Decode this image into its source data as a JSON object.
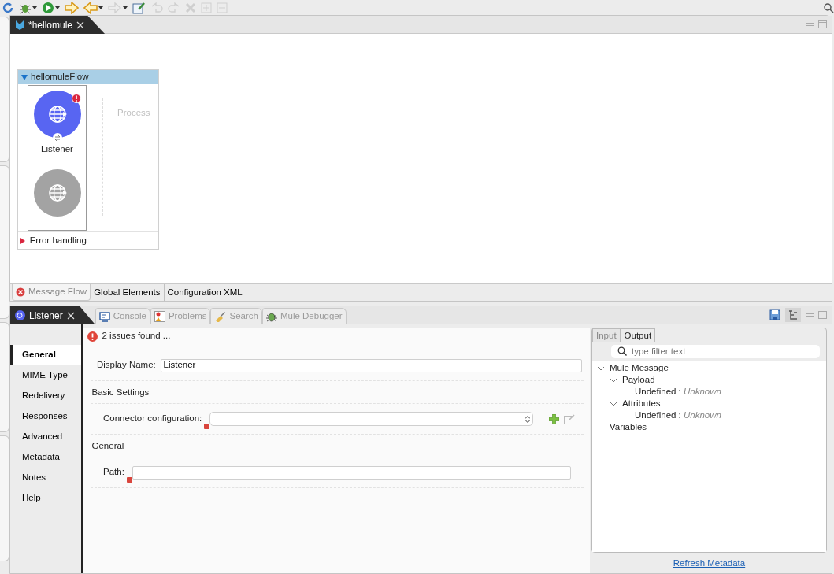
{
  "toolbar": [
    {
      "kind": "refresh",
      "disabled": false
    },
    {
      "kind": "debug",
      "disabled": false,
      "dropdown": true
    },
    {
      "kind": "run",
      "disabled": false,
      "dropdown": true
    },
    {
      "kind": "forward",
      "disabled": false
    },
    {
      "kind": "back",
      "disabled": false,
      "dropdown": true
    },
    {
      "kind": "next",
      "disabled": true,
      "dropdown": true
    },
    {
      "kind": "edit",
      "disabled": false
    },
    {
      "kind": "undo",
      "disabled": true
    },
    {
      "kind": "redo",
      "disabled": true
    },
    {
      "kind": "delete",
      "disabled": true
    },
    {
      "kind": "expand",
      "disabled": true
    },
    {
      "kind": "collapse",
      "disabled": true
    }
  ],
  "editor": {
    "tabs": [
      {
        "label": "*hellomule",
        "selected": true
      }
    ],
    "flow": {
      "title": "hellomuleFlow",
      "expanded": true,
      "source": {
        "label": "Listener",
        "has_error": true
      },
      "process_label": "Process",
      "error_handling": {
        "label": "Error handling",
        "expanded": false
      }
    },
    "bottom_tabs": [
      {
        "label": "Message Flow",
        "selected": true,
        "has_error": true
      },
      {
        "label": "Global Elements",
        "selected": false,
        "has_error": false
      },
      {
        "label": "Configuration XML",
        "selected": false,
        "has_error": false
      }
    ]
  },
  "views": {
    "tabs": [
      {
        "label": "Listener",
        "kind": "listener",
        "selected": true
      },
      {
        "label": "Console",
        "kind": "console",
        "selected": false
      },
      {
        "label": "Problems",
        "kind": "problems",
        "selected": false
      },
      {
        "label": "Search",
        "kind": "search",
        "selected": false
      },
      {
        "label": "Mule Debugger",
        "kind": "debugger",
        "selected": false
      }
    ]
  },
  "properties": {
    "issues": "2 issues found ...",
    "nav": [
      {
        "label": "General",
        "selected": true
      },
      {
        "label": "MIME Type",
        "selected": false
      },
      {
        "label": "Redelivery",
        "selected": false
      },
      {
        "label": "Responses",
        "selected": false
      },
      {
        "label": "Advanced",
        "selected": false
      },
      {
        "label": "Metadata",
        "selected": false
      },
      {
        "label": "Notes",
        "selected": false
      },
      {
        "label": "Help",
        "selected": false
      }
    ],
    "display_name": {
      "label": "Display Name:",
      "value": "Listener"
    },
    "sections": [
      {
        "title": "Basic Settings",
        "field": {
          "kind": "select",
          "label": "Connector configuration:",
          "has_error": true
        }
      },
      {
        "title": "General",
        "field": {
          "kind": "text",
          "label": "Path:",
          "has_error": true
        }
      }
    ]
  },
  "metadata": {
    "tabs": [
      {
        "label": "Input",
        "selected": false
      },
      {
        "label": "Output",
        "selected": true
      }
    ],
    "filter_placeholder": "type filter text",
    "tree": [
      {
        "label": "Mule Message",
        "expanded": true,
        "children": [
          {
            "label": "Payload",
            "expanded": true,
            "children": [
              {
                "label": "Undefined : *Unknown*"
              }
            ]
          },
          {
            "label": "Attributes",
            "expanded": true,
            "children": [
              {
                "label": "Undefined : *Unknown*"
              }
            ]
          }
        ]
      },
      {
        "label": "Variables"
      }
    ],
    "refresh_link": "Refresh Metadata"
  }
}
